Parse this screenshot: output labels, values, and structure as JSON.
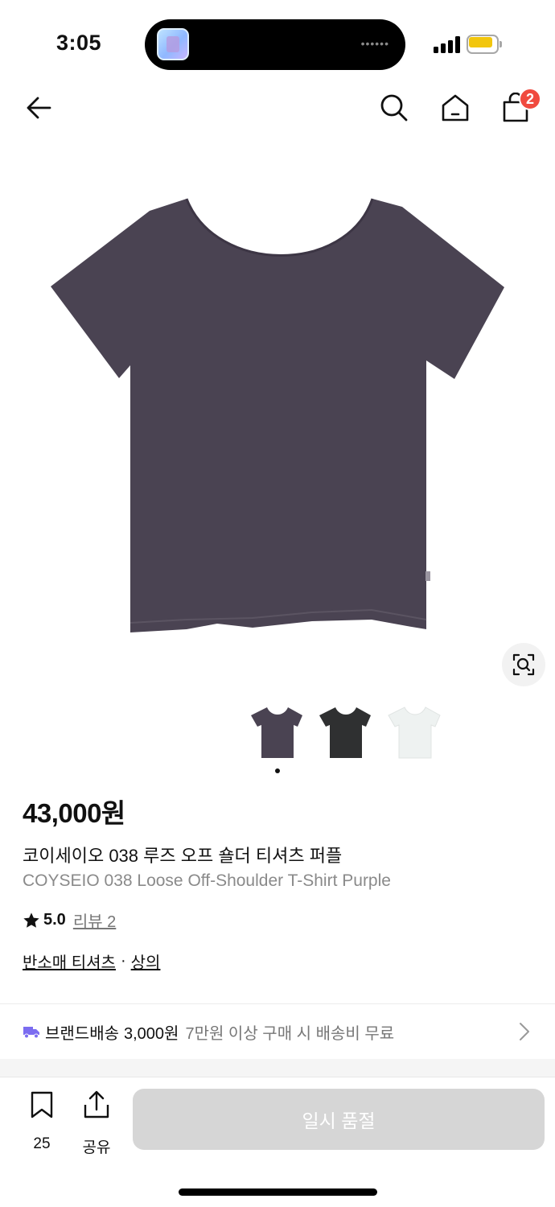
{
  "status_bar": {
    "time": "3:05",
    "battery_color": "#f2c60d"
  },
  "nav": {
    "cart_count": "2"
  },
  "product": {
    "price": "43,000원",
    "name_ko": "코이세이오 038 루즈 오프 숄더 티셔츠 퍼플",
    "name_en": "COYSEIO 038 Loose Off-Shoulder T-Shirt Purple",
    "rating": "5.0",
    "review_label": "리뷰 2",
    "category_primary": "반소매 티셔츠",
    "category_sep": "·",
    "category_secondary": "상의",
    "main_color": "#4a4352",
    "thumbnails": [
      {
        "name": "purple",
        "color": "#4a4352"
      },
      {
        "name": "charcoal",
        "color": "#2f3031"
      },
      {
        "name": "white",
        "color": "#eef2f1"
      }
    ]
  },
  "shipping": {
    "brand_label": "브랜드배송",
    "fee": "3,000원",
    "condition": "7만원 이상 구매 시 배송비 무료",
    "icon_color": "#7b6cf0"
  },
  "bottom_bar": {
    "like_count": "25",
    "share_label": "공유",
    "soldout_label": "일시 품절"
  },
  "icons": [
    "back-arrow-icon",
    "search-icon",
    "home-icon",
    "cart-icon",
    "image-search-icon",
    "star-icon",
    "truck-icon",
    "chevron-right-icon",
    "bookmark-icon",
    "share-icon"
  ]
}
